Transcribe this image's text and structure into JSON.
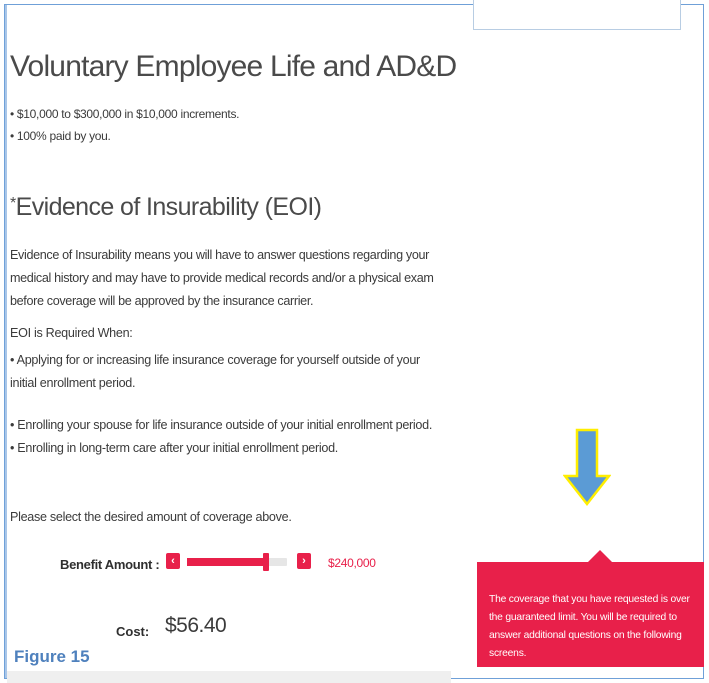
{
  "main": {
    "title": "Voluntary Employee Life and AD&D",
    "bullets": [
      "• $10,000 to $300,000 in $10,000 increments.",
      "• 100% paid by you."
    ],
    "eoi_star": "*",
    "eoi_heading": "Evidence of Insurability (EOI)",
    "eoi_description": "Evidence of Insurability means you will have to answer questions regarding your medical history and may have to provide medical records and/or a physical exam before coverage will be approved by the insurance carrier.",
    "eoi_required_heading": "EOI is Required When:",
    "eoi_required_items": [
      "• Applying for or increasing life insurance coverage for yourself outside of your initial enrollment period.",
      "• Enrolling your spouse for life insurance outside of your initial enrollment period.",
      "• Enrolling in long-term care after your initial enrollment period."
    ],
    "select_prompt": "Please select the desired amount of coverage above."
  },
  "benefit": {
    "label": "Benefit Amount :",
    "decrease_glyph": "‹",
    "increase_glyph": "›",
    "value_text": "$240,000",
    "min": 10000,
    "max": 300000,
    "value": 240000
  },
  "cost": {
    "label": "Cost:",
    "value": "$56.40"
  },
  "tooltip": {
    "text": "The coverage that you have requested is over the guaranteed limit. You will be required to answer additional questions on the following screens."
  },
  "caption": "Figure 15",
  "colors": {
    "accent": "#e8204a",
    "arrow_fill": "#5b9bd5",
    "arrow_stroke": "#ffee00",
    "caption": "#4f81bd"
  },
  "icons": {
    "annotation_arrow": "down-arrow-icon"
  }
}
